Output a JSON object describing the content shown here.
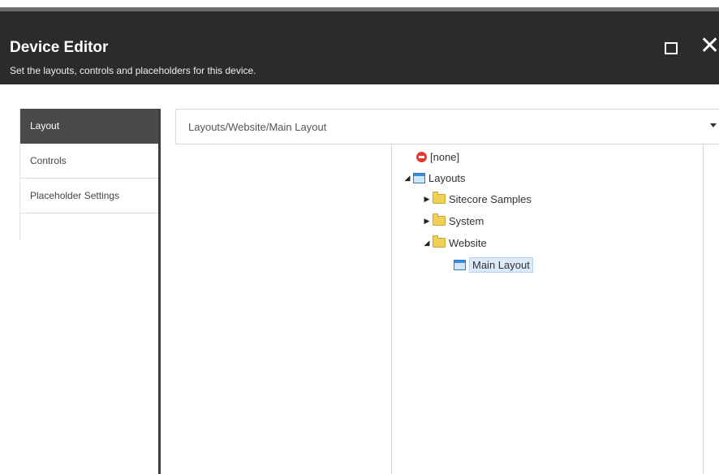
{
  "dialog": {
    "title": "Device Editor",
    "subtitle": "Set the layouts, controls and placeholders for this device.",
    "maximize_icon": "maximize-icon",
    "close_icon": "close-icon"
  },
  "nav": {
    "items": [
      {
        "label": "Layout",
        "active": true
      },
      {
        "label": "Controls",
        "active": false
      },
      {
        "label": "Placeholder Settings",
        "active": false
      }
    ]
  },
  "layout_select": {
    "value": "Layouts/Website/Main Layout"
  },
  "tree": {
    "none": "[none]",
    "layouts": "Layouts",
    "sitecore_samples": "Sitecore Samples",
    "system": "System",
    "website": "Website",
    "main_layout": "Main Layout"
  },
  "colors": {
    "header_bg": "#2b2b2b",
    "nav_active_bg": "#4a4a4a",
    "selection_bg": "#dceaf9"
  }
}
